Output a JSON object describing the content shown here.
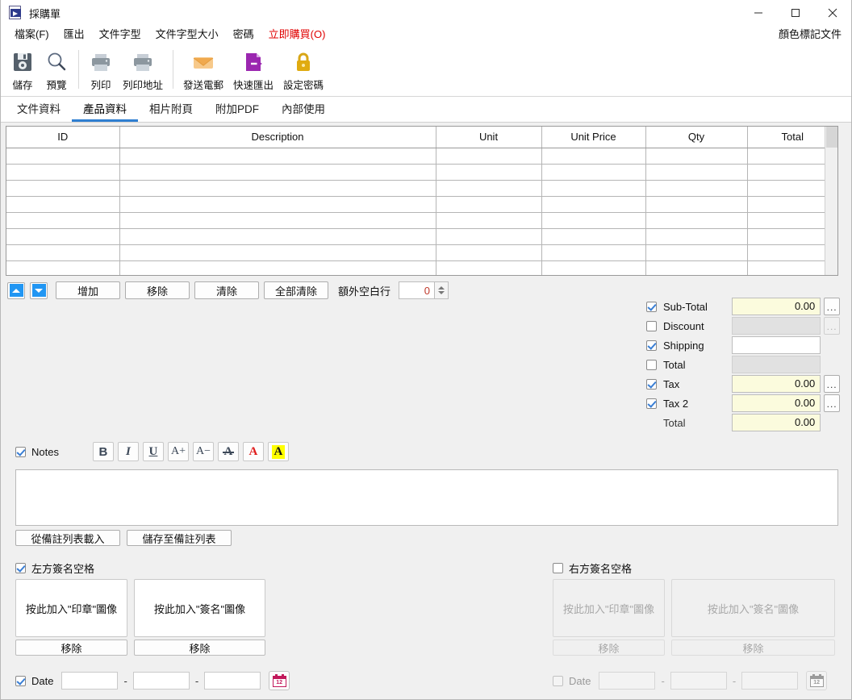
{
  "window": {
    "title": "採購單",
    "icon": "document-export-icon",
    "minimize": "minimize-icon",
    "maximize": "maximize-icon",
    "close": "close-icon"
  },
  "menubar": {
    "items": [
      {
        "label": "檔案(F)",
        "accent": false
      },
      {
        "label": "匯出",
        "accent": false
      },
      {
        "label": "文件字型",
        "accent": false
      },
      {
        "label": "文件字型大小",
        "accent": false
      },
      {
        "label": "密碼",
        "accent": false
      },
      {
        "label": "立即購買(O)",
        "accent": true
      }
    ],
    "right_label": "顏色標記文件"
  },
  "toolbar": {
    "items": [
      {
        "label": "儲存",
        "icon": "floppy-disk-icon"
      },
      {
        "label": "預覽",
        "icon": "magnifier-icon"
      },
      {
        "label": "列印",
        "icon": "printer-icon"
      },
      {
        "label": "列印地址",
        "icon": "printer-icon"
      },
      {
        "label": "發送電郵",
        "icon": "envelope-icon"
      },
      {
        "label": "快速匯出",
        "icon": "document-export-icon"
      },
      {
        "label": "設定密碼",
        "icon": "padlock-icon"
      }
    ]
  },
  "tabs": {
    "items": [
      {
        "label": "文件資料",
        "active": false
      },
      {
        "label": "產品資料",
        "active": true
      },
      {
        "label": "相片附頁",
        "active": false
      },
      {
        "label": "附加PDF",
        "active": false
      },
      {
        "label": "內部使用",
        "active": false
      }
    ],
    "accent_color": "#2f7fd1"
  },
  "grid": {
    "columns": [
      "ID",
      "Description",
      "Unit",
      "Unit Price",
      "Qty",
      "Total"
    ],
    "row_count": 8,
    "rows": [
      [
        "",
        "",
        "",
        "",
        "",
        ""
      ],
      [
        "",
        "",
        "",
        "",
        "",
        ""
      ],
      [
        "",
        "",
        "",
        "",
        "",
        ""
      ],
      [
        "",
        "",
        "",
        "",
        "",
        ""
      ],
      [
        "",
        "",
        "",
        "",
        "",
        ""
      ],
      [
        "",
        "",
        "",
        "",
        "",
        ""
      ],
      [
        "",
        "",
        "",
        "",
        "",
        ""
      ],
      [
        "",
        "",
        "",
        "",
        "",
        ""
      ]
    ],
    "total_column_bg": "#fbfbdd"
  },
  "row_controls": {
    "move_up": "up-arrow-icon",
    "move_down": "down-arrow-icon",
    "add": "增加",
    "remove": "移除",
    "clear": "清除",
    "clear_all": "全部清除",
    "extra_rows_label": "額外空白行",
    "extra_rows_value": "0"
  },
  "totals": {
    "rows": [
      {
        "label": "Sub-Total",
        "checked": true,
        "value": "0.00",
        "style": "yellow",
        "dots": "enabled"
      },
      {
        "label": "Discount",
        "checked": false,
        "value": "",
        "style": "gray",
        "dots": "disabled"
      },
      {
        "label": "Shipping",
        "checked": true,
        "value": "",
        "style": "white",
        "dots": "none"
      },
      {
        "label": "Total",
        "checked": false,
        "value": "",
        "style": "gray",
        "dots": "none"
      },
      {
        "label": "Tax",
        "checked": true,
        "value": "0.00",
        "style": "yellow",
        "dots": "enabled"
      },
      {
        "label": "Tax 2",
        "checked": true,
        "value": "0.00",
        "style": "yellow",
        "dots": "enabled"
      },
      {
        "label": "Total",
        "checked": null,
        "value": "0.00",
        "style": "yellow",
        "dots": "none"
      }
    ]
  },
  "notes": {
    "label": "Notes",
    "checked": true,
    "text": "",
    "format_buttons": [
      {
        "glyph": "B",
        "name": "bold-icon"
      },
      {
        "glyph": "I",
        "name": "italic-icon"
      },
      {
        "glyph": "U",
        "name": "underline-icon"
      },
      {
        "glyph": "A+",
        "name": "increase-font-size-icon"
      },
      {
        "glyph": "A−",
        "name": "decrease-font-size-icon"
      },
      {
        "glyph": "A",
        "name": "strikethrough-icon"
      },
      {
        "glyph": "A",
        "name": "font-color-icon"
      },
      {
        "glyph": "A",
        "name": "highlight-color-icon"
      }
    ],
    "load_button": "從備註列表載入",
    "save_button": "儲存至備註列表"
  },
  "signature_left": {
    "label": "左方簽名空格",
    "checked": true,
    "stamp_placeholder": "按此加入\"印章\"圖像",
    "sign_placeholder": "按此加入\"簽名\"圖像",
    "remove_label": "移除"
  },
  "signature_right": {
    "label": "右方簽名空格",
    "checked": false,
    "stamp_placeholder": "按此加入\"印章\"圖像",
    "sign_placeholder": "按此加入\"簽名\"圖像",
    "remove_label": "移除"
  },
  "date_left": {
    "label": "Date",
    "checked": true,
    "year": "",
    "month": "",
    "day": "",
    "separator": "-",
    "calendar_icon": "calendar-icon"
  },
  "date_right": {
    "label": "Date",
    "checked": false,
    "year": "",
    "month": "",
    "day": "",
    "separator": "-",
    "calendar_icon": "calendar-icon"
  }
}
